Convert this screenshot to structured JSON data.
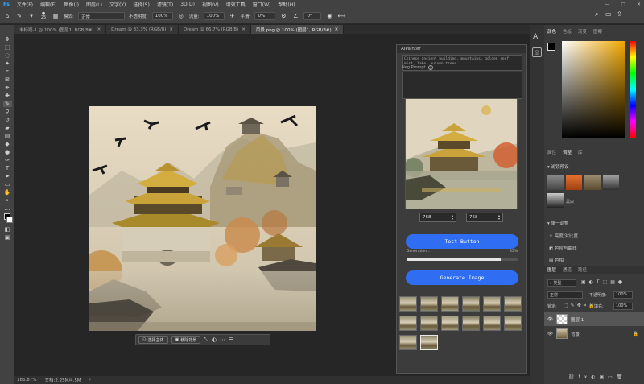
{
  "menubar": {
    "items": [
      "文件(F)",
      "编辑(E)",
      "图像(I)",
      "图层(L)",
      "文字(Y)",
      "选择(S)",
      "滤镜(T)",
      "3D(D)",
      "视图(V)",
      "增效工具",
      "窗口(W)",
      "帮助(H)"
    ],
    "window_controls": [
      "—",
      "▢",
      "✕"
    ]
  },
  "options_bar": {
    "mode_label": "模式:",
    "mode_value": "正常",
    "opacity_label": "不透明度:",
    "opacity_value": "100%",
    "flow_label": "流量:",
    "flow_value": "100%",
    "smooth_label": "平滑:",
    "smooth_value": "0%",
    "angle_value": "0°",
    "brush_size": "25"
  },
  "tabs": [
    {
      "label": "未标题-1 @ 100% (图层1, RGB/8#)",
      "active": false
    },
    {
      "label": "Dream @ 33.3% (RGB/8)",
      "active": false
    },
    {
      "label": "Dream @ 66.7% (RGB/8)",
      "active": false
    },
    {
      "label": "风景.png @ 100% (图层1, RGB/8#)",
      "active": true
    }
  ],
  "status_bar": {
    "zoom": "186.87%",
    "doc_info": "文档:2.25M/4.5M"
  },
  "context_bar": {
    "select_subject": "选择主体",
    "remove_bg": "移除背景"
  },
  "plugin": {
    "title": "AIPainter",
    "prompt_text": "Chinese ancient building, mountains, golden roof, mist, lake, autumn trees...",
    "neg_label": "Neg Prompt",
    "width_value": "768",
    "height_value": "768",
    "test_button": "Test Button",
    "progress_label": "Generation...",
    "progress_value": "85%",
    "progress_fraction": 0.85,
    "generate_button": "Generate Image"
  },
  "right_panel": {
    "color_tabs": [
      "颜色",
      "色板",
      "渐变",
      "图案"
    ],
    "adjust_tabs": [
      "属性",
      "调整",
      "库"
    ],
    "presets_label": "滤镜预设",
    "preset_item": "黑白",
    "single_adjust_label": "单一调整",
    "adjust_items": [
      "亮度/对比度",
      "色阶与曲线",
      "色相"
    ],
    "layers_tabs": [
      "图层",
      "通道",
      "路径"
    ],
    "filter_kind": "类型",
    "blend_mode": "正常",
    "opacity_label": "不透明度:",
    "opacity_value": "100%",
    "lock_label": "锁定:",
    "fill_label": "填充:",
    "fill_value": "100%",
    "layers": [
      {
        "name": "图层 1",
        "selected": true
      },
      {
        "name": "背景",
        "selected": false
      }
    ]
  },
  "colors": {
    "accent_blue": "#2f6df2",
    "app_bg": "#262626",
    "panel_bg": "#3a3a3a"
  }
}
